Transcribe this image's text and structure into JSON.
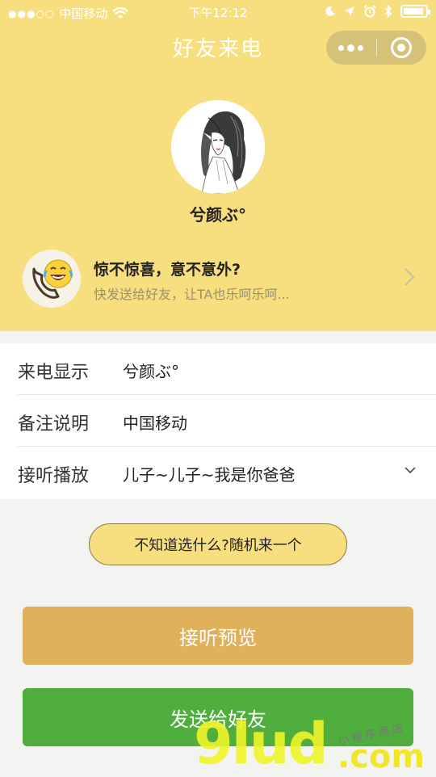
{
  "status_bar": {
    "carrier": "中国移动",
    "time": "下午12:12"
  },
  "nav": {
    "title": "好友来电"
  },
  "profile": {
    "nickname": "兮颜ぶ°"
  },
  "promo": {
    "title": "惊不惊喜，意不意外?",
    "subtitle": "快发送给好友，让TA也乐呵乐呵..."
  },
  "form": {
    "rows": [
      {
        "label": "来电显示",
        "value": "兮颜ぶ°"
      },
      {
        "label": "备注说明",
        "value": "中国移动"
      },
      {
        "label": "接听播放",
        "value": "儿子~儿子~我是你爸爸"
      }
    ]
  },
  "actions": {
    "random_label": "不知道选什么?随机来一个",
    "preview_label": "接听预览",
    "send_label": "发送给好友"
  },
  "watermark": {
    "brand": "9lud",
    "domain": ".com",
    "tag": "小程序商店"
  },
  "colors": {
    "header_bg": "#f7de7e",
    "preview_btn": "#e1b05a",
    "send_btn": "#4fae3e",
    "page_bg": "#f3f3f1"
  },
  "icons": {
    "wifi": "wifi-icon",
    "moon": "moon-icon",
    "location": "location-icon",
    "alarm": "alarm-icon",
    "bluetooth": "bluetooth-icon",
    "battery": "battery-icon",
    "more": "more-dots-icon",
    "close": "mini-program-close-icon",
    "promo": "laughing-phone-icon",
    "arrow": "chevron-right-icon",
    "dropdown": "chevron-down-icon"
  }
}
